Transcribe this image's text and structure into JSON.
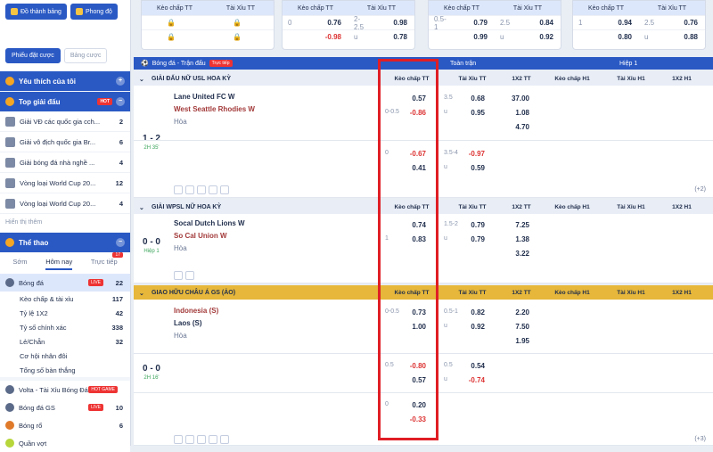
{
  "sidebar": {
    "pills": [
      "Đồ thành bảng",
      "Phong độ"
    ],
    "tabs": [
      "Phiếu đặt cược",
      "Bảng cược"
    ],
    "favorites_title": "Yêu thích của tôi",
    "top_leagues_title": "Top giải đấu",
    "hot_label": "HOT",
    "leagues": [
      {
        "name": "Giải VĐ các quốc gia cch...",
        "count": "2"
      },
      {
        "name": "Giải vô địch quốc gia Br...",
        "count": "6"
      },
      {
        "name": "Giải bóng đá nhà nghề ...",
        "count": "4"
      },
      {
        "name": "Vòng loại World Cup 20...",
        "count": "12"
      },
      {
        "name": "Vòng loại World Cup 20...",
        "count": "4"
      }
    ],
    "show_all": "Hiển thị thêm",
    "sports_title": "Thể thao",
    "day_tabs": [
      "Sớm",
      "Hôm nay",
      "Trực tiếp"
    ],
    "live_count_badge": "17",
    "football": {
      "name": "Bóng đá",
      "live": "LIVE",
      "count": "22"
    },
    "sub_items": [
      {
        "name": "Kèo chấp & tài xỉu",
        "count": "117"
      },
      {
        "name": "Tỷ lệ 1X2",
        "count": "42"
      },
      {
        "name": "Tỷ số chính xác",
        "count": "338"
      },
      {
        "name": "Lẻ/Chẵn",
        "count": "32"
      },
      {
        "name": "Cơ hội nhân đôi",
        "count": ""
      },
      {
        "name": "Tổng số bàn thắng",
        "count": ""
      }
    ],
    "other_sports": [
      {
        "name": "Volta - Tài Xỉu Bóng Đá",
        "tag": "HOT GAME",
        "count": ""
      },
      {
        "name": "Bóng đá GS",
        "tag": "LIVE",
        "count": "10"
      },
      {
        "name": "Bóng rổ",
        "tag": "",
        "count": "6"
      },
      {
        "name": "Quần vợt",
        "tag": "",
        "count": ""
      }
    ]
  },
  "top_cards": [
    {
      "h1": "Kèo chấp TT",
      "h2": "Tài Xỉu TT",
      "rows": [
        [
          "",
          "",
          "",
          ""
        ],
        [
          "",
          "",
          "",
          ""
        ]
      ]
    },
    {
      "h1": "Kèo chấp TT",
      "h2": "Tài Xỉu TT",
      "rows": [
        [
          "0",
          "0.76",
          "2-2.5",
          "0.98"
        ],
        [
          "",
          "-0.98",
          "u",
          "0.78"
        ]
      ]
    },
    {
      "h1": "Kèo chấp TT",
      "h2": "Tài Xỉu TT",
      "rows": [
        [
          "0.5-1",
          "0.79",
          "2.5",
          "0.84"
        ],
        [
          "",
          "0.99",
          "u",
          "0.92"
        ]
      ]
    },
    {
      "h1": "Kèo chấp TT",
      "h2": "Tài Xỉu TT",
      "rows": [
        [
          "1",
          "0.94",
          "2.5",
          "0.76"
        ],
        [
          "",
          "0.80",
          "u",
          "0.88"
        ]
      ]
    }
  ],
  "bar": {
    "sport": "Bóng đá - Trận đấu",
    "live": "Trực tiếp",
    "full": "Toàn trận",
    "half": "Hiệp 1"
  },
  "cols": {
    "hdp": "Kèo chấp TT",
    "ou": "Tài Xỉu TT",
    "x12": "1X2 TT",
    "hdp1": "Kèo chấp H1",
    "ou1": "Tài Xỉu H1",
    "x121": "1X2 H1"
  },
  "leagues": [
    {
      "name": "GIẢI ĐẤU NỮ USL HOA KỲ"
    },
    {
      "name": "GIẢI WPSL NỮ HOA KỲ"
    },
    {
      "name": "GIAO HỮU CHÂU Á GS (ẢO)"
    }
  ],
  "matches": [
    {
      "score": "1 - 2",
      "status": "2H 35'",
      "home": "Lane United FC W",
      "away": "West Seattle Rhodies W",
      "draw": "Hòa",
      "l1": {
        "hc": "",
        "v1": "0.57",
        "ouh": "3.5",
        "o1": "0.68",
        "x": "37.00"
      },
      "l2": {
        "hc": "0-0.5",
        "v1": "-0.86",
        "ouh": "u",
        "o1": "0.95",
        "x": "1.08"
      },
      "l3": {
        "x": "4.70"
      },
      "l4": {
        "hc": "0",
        "v1": "-0.67",
        "ouh": "3.5-4",
        "o1": "-0.97"
      },
      "l5": {
        "hc": "",
        "v1": "0.41",
        "ouh": "u",
        "o1": "0.59"
      },
      "more": "(+2)"
    },
    {
      "score": "0 - 0",
      "status": "Hiệp 1",
      "home": "Socal Dutch Lions W",
      "away": "So Cal Union W",
      "draw": "Hòa",
      "l1": {
        "hc": "",
        "v1": "0.74",
        "ouh": "1.5-2",
        "o1": "0.79",
        "x": "7.25"
      },
      "l2": {
        "hc": "1",
        "v1": "0.83",
        "ouh": "u",
        "o1": "0.79",
        "x": "1.38"
      },
      "l3": {
        "x": "3.22"
      }
    },
    {
      "score": "0 - 0",
      "status": "2H 16'",
      "home": "Indonesia (S)",
      "away": "Laos (S)",
      "draw": "Hòa",
      "l1": {
        "hc": "0-0.5",
        "v1": "0.73",
        "ouh": "0.5-1",
        "o1": "0.82",
        "x": "2.20"
      },
      "l2": {
        "hc": "",
        "v1": "1.00",
        "ouh": "u",
        "o1": "0.92",
        "x": "7.50"
      },
      "l3": {
        "x": "1.95"
      },
      "l4": {
        "hc": "0.5",
        "v1": "-0.80",
        "ouh": "0.5",
        "o1": "0.54"
      },
      "l5": {
        "hc": "",
        "v1": "0.57",
        "ouh": "u",
        "o1": "-0.74"
      },
      "l6": {
        "hc": "0",
        "v1": "0.20"
      },
      "l7": {
        "hc": "",
        "v1": "-0.33"
      },
      "more": "(+3)"
    }
  ]
}
